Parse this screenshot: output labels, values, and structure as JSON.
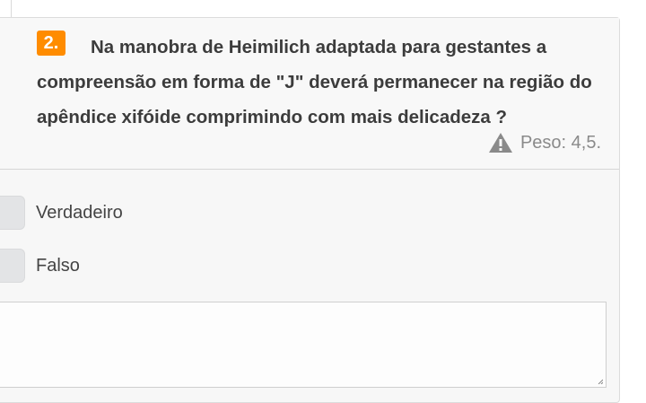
{
  "question": {
    "number": "2.",
    "text": "Na manobra de Heimilich adaptada para gestantes a compreensão em forma de \"J\" deverá permanecer na região do apêndice xifóide comprimindo com mais delicadeza ?",
    "weight_label": "Peso: 4,5.",
    "badge_color": "#ff8c00"
  },
  "options": [
    {
      "label": "Verdadeiro"
    },
    {
      "label": "Falso"
    }
  ],
  "icons": {
    "weight": "warning-triangle-icon"
  }
}
